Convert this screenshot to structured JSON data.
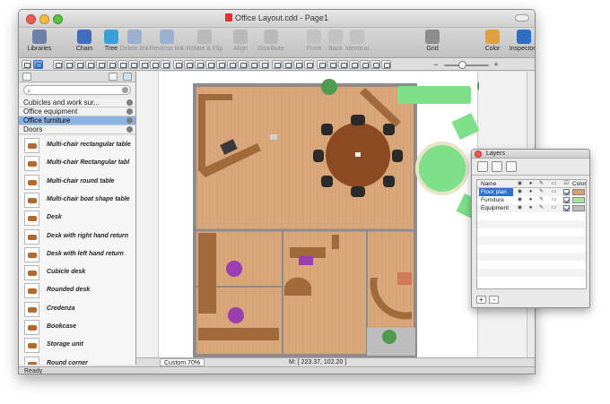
{
  "window": {
    "title": "Office Layout.cdd - Page1"
  },
  "toolbar": {
    "items": [
      {
        "label": "Libraries",
        "icon": "libraries-icon",
        "dim": false
      },
      {
        "label": "Chain",
        "icon": "chain-icon",
        "dim": false
      },
      {
        "label": "Tree",
        "icon": "tree-icon",
        "dim": false
      },
      {
        "label": "Delete link",
        "icon": "delete-link-icon",
        "dim": true
      },
      {
        "label": "Reverse link",
        "icon": "reverse-link-icon",
        "dim": true
      },
      {
        "label": "Rotate & Flip",
        "icon": "rotate-flip-icon",
        "dim": true
      },
      {
        "label": "Align",
        "icon": "align-icon",
        "dim": true
      },
      {
        "label": "Distribute",
        "icon": "distribute-icon",
        "dim": true
      },
      {
        "label": "Front",
        "icon": "front-icon",
        "dim": true
      },
      {
        "label": "Back",
        "icon": "back-icon",
        "dim": true
      },
      {
        "label": "Identical",
        "icon": "identical-icon",
        "dim": true
      },
      {
        "label": "Grid",
        "icon": "grid-icon",
        "dim": false
      },
      {
        "label": "Color",
        "icon": "color-icon",
        "dim": false
      },
      {
        "label": "Inspectors",
        "icon": "inspectors-icon",
        "dim": false
      }
    ]
  },
  "sidebar": {
    "libraries": [
      {
        "label": "Cubicles and work sur...",
        "selected": false
      },
      {
        "label": "Office equipment",
        "selected": false
      },
      {
        "label": "Office furniture",
        "selected": true
      },
      {
        "label": "Doors",
        "selected": false
      }
    ],
    "stencils": [
      "Multi-chair rectangular table",
      "Multi-chair Rectangular tabl",
      "Multi-chair round table",
      "Multi-chair boat shape table",
      "Desk",
      "Desk with right hand return",
      "Desk with left hand return",
      "Cubicle desk",
      "Rounded desk",
      "Credenza",
      "Bookcase",
      "Storage unit",
      "Round corner"
    ]
  },
  "status": {
    "zoom": "Custom 70%",
    "coords": "M: [ 223.37, 102.20 ]",
    "ready": "Ready"
  },
  "layers": {
    "title": "Layers",
    "header": {
      "name": "Name",
      "color": "Color"
    },
    "rows": [
      {
        "name": "Floor plan",
        "color": "#d8a06e",
        "selected": true
      },
      {
        "name": "Furniture",
        "color": "#a4e3a0",
        "selected": false
      },
      {
        "name": "Equipment",
        "color": "#bcbcbc",
        "selected": false
      }
    ],
    "add_label": "+",
    "remove_label": "-"
  },
  "colors": {
    "floor": "#d9a77a",
    "wall": "#8c8c8c",
    "furniture": "#a06a3a",
    "green": "#7fe08a",
    "purple": "#9b3fb0"
  }
}
